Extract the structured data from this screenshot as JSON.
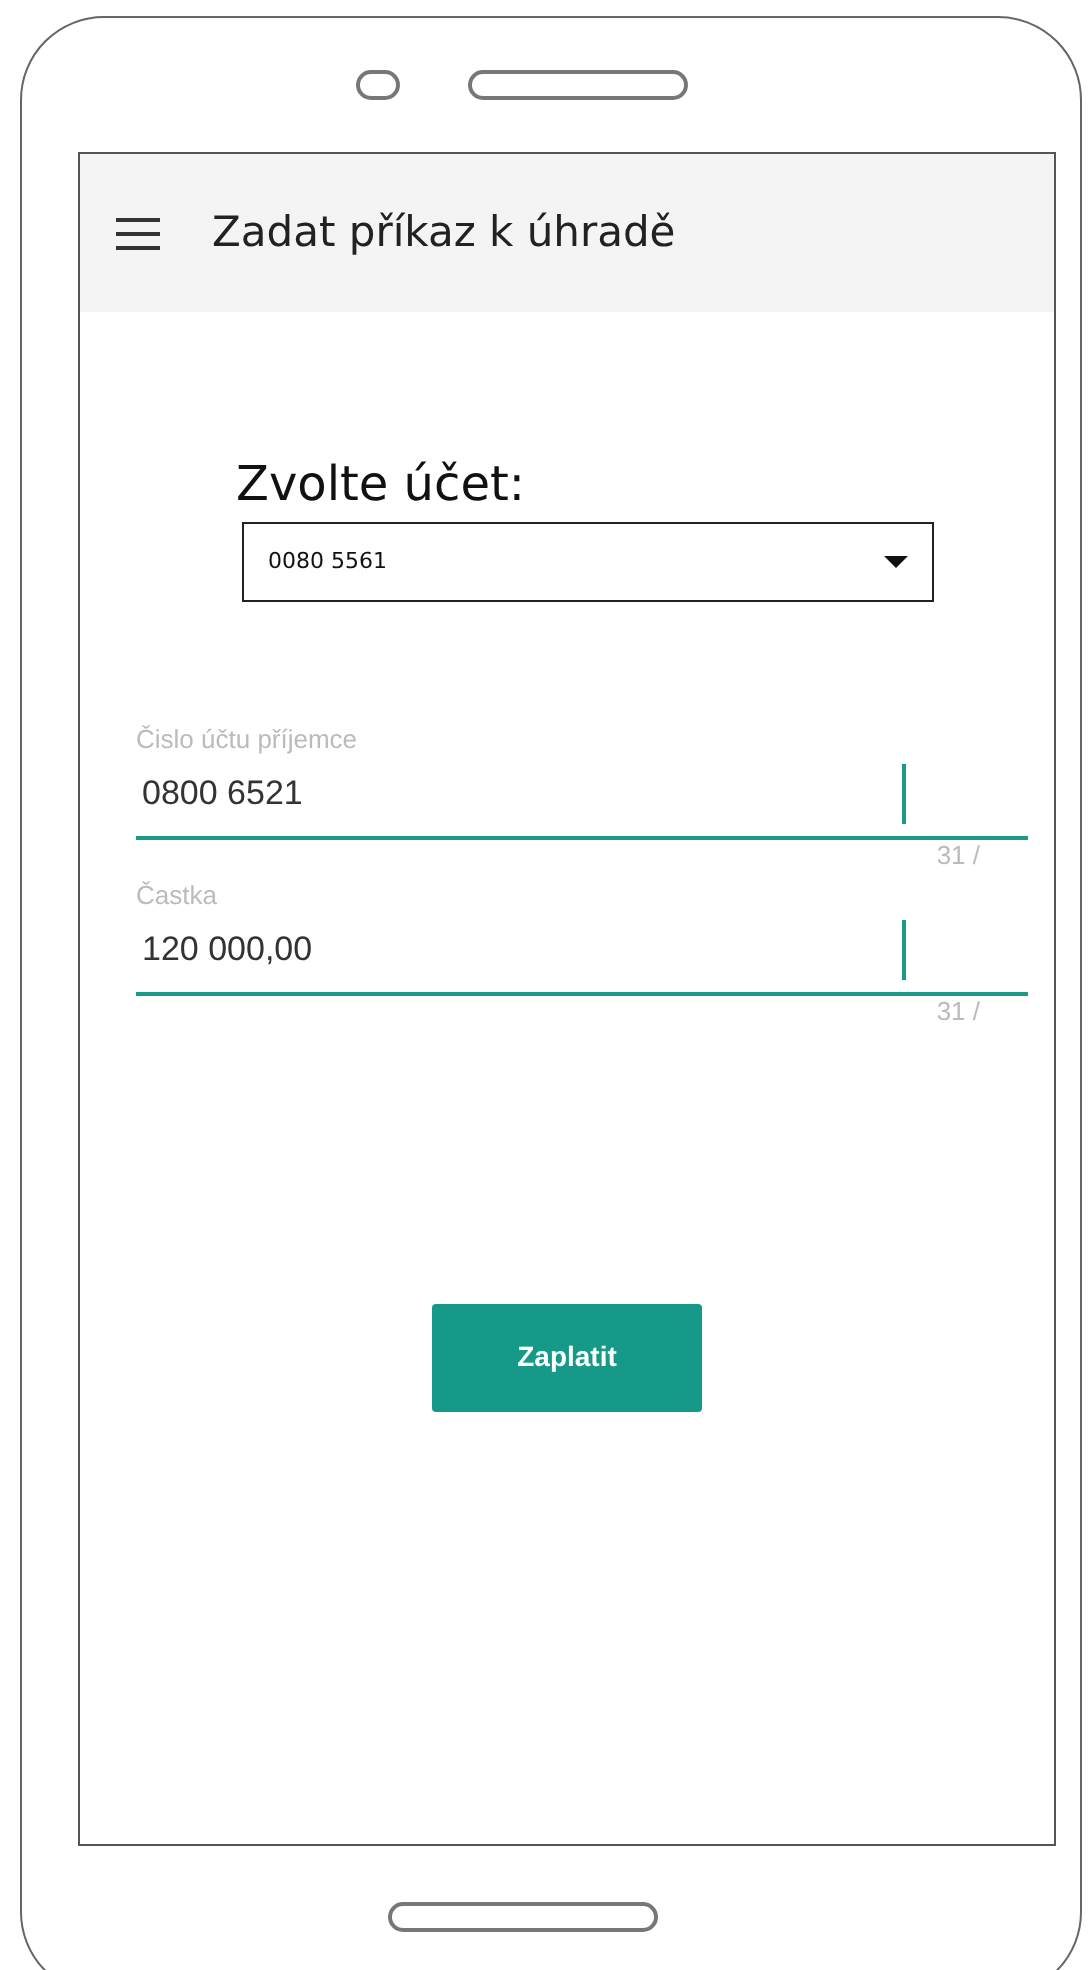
{
  "header": {
    "title": "Zadat příkaz k úhradě"
  },
  "account_select": {
    "label": "Zvolte účet:",
    "value": "0080 5561"
  },
  "fields": [
    {
      "label": "Čislo účtu příjemce",
      "value": "0800 6521",
      "counter": "31 /"
    },
    {
      "label": "Častka",
      "value": "120 000,00",
      "counter": "31 /"
    }
  ],
  "pay_button": {
    "label": "Zaplatit"
  }
}
